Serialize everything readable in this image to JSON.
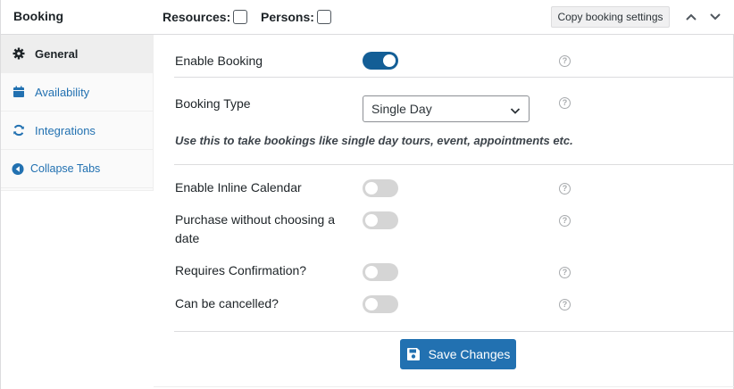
{
  "header": {
    "title": "Booking",
    "resources_label": "Resources:",
    "persons_label": "Persons:",
    "copy_button": "Copy booking settings"
  },
  "sidebar": {
    "items": [
      {
        "label": "General",
        "icon": "gear-icon",
        "active": true
      },
      {
        "label": "Availability",
        "icon": "calendar-icon",
        "active": false
      },
      {
        "label": "Integrations",
        "icon": "sync-icon",
        "active": false
      },
      {
        "label": "Collapse Tabs",
        "icon": "collapse-arrow-icon",
        "active": false
      }
    ]
  },
  "general": {
    "enable_booking": {
      "label": "Enable Booking",
      "enabled": true
    },
    "booking_type": {
      "label": "Booking Type",
      "selected": "Single Day",
      "hint": "Use this to take bookings like single day tours, event, appointments etc."
    },
    "inline_calendar": {
      "label": "Enable Inline Calendar",
      "enabled": false
    },
    "purchase_without_date": {
      "label_line1": "Purchase without choosing a",
      "label_line2": "date",
      "enabled": false
    },
    "requires_confirmation": {
      "label": "Requires Confirmation?",
      "enabled": false
    },
    "can_be_cancelled": {
      "label": "Can be cancelled?",
      "enabled": false
    },
    "help_glyph": "?",
    "save_button": "Save Changes"
  },
  "colors": {
    "accent": "#2271b1",
    "toggle_on": "#135e96",
    "toggle_off": "#d5d5d5"
  }
}
